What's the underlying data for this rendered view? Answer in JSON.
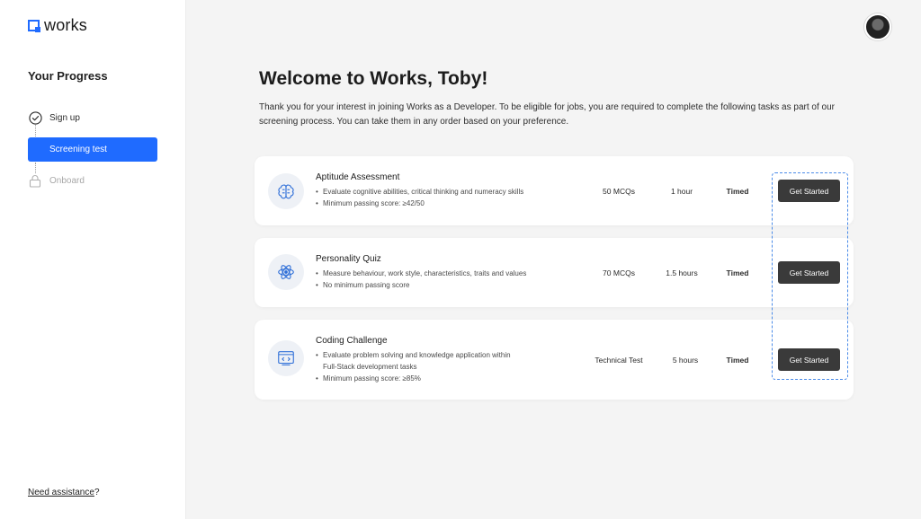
{
  "brand": {
    "name": "works",
    "color": "#1f6bff"
  },
  "sidebar": {
    "title": "Your Progress",
    "steps": [
      {
        "label": "Sign up",
        "state": "completed",
        "icon": "check-circle-icon"
      },
      {
        "label": "Screening test",
        "state": "active"
      },
      {
        "label": "Onboard",
        "state": "locked",
        "icon": "lock-icon"
      }
    ],
    "assist_link": "Need assistance",
    "assist_suffix": "?"
  },
  "header": {
    "avatar_icon": "user-avatar"
  },
  "main": {
    "title": "Welcome to Works, Toby!",
    "intro": "Thank you for your interest in joining Works as a Developer. To be eligible for jobs, you are required to complete the following tasks as part of our screening process. You can take them in any order based on your preference.",
    "tasks": [
      {
        "title": "Aptitude  Assessment",
        "icon": "brain-icon",
        "bullets": [
          "Evaluate cognitive abilities, critical thinking and numeracy skills",
          "Minimum passing score: ≥42/50"
        ],
        "questions": "50 MCQs",
        "duration": "1 hour",
        "mode": "Timed",
        "button": "Get Started"
      },
      {
        "title": "Personality Quiz",
        "icon": "atom-icon",
        "bullets": [
          "Measure behaviour, work style, characteristics, traits and values",
          "No minimum passing score"
        ],
        "questions": "70 MCQs",
        "duration": "1.5 hours",
        "mode": "Timed",
        "button": "Get Started"
      },
      {
        "title": "Coding Challenge",
        "icon": "code-window-icon",
        "bullets": [
          "Evaluate problem solving and knowledge application  within",
          "Full-Stack development tasks",
          "Minimum passing score: ≥85%"
        ],
        "questions": "Technical Test",
        "duration": "5 hours",
        "mode": "Timed",
        "button": "Get Started"
      }
    ]
  }
}
